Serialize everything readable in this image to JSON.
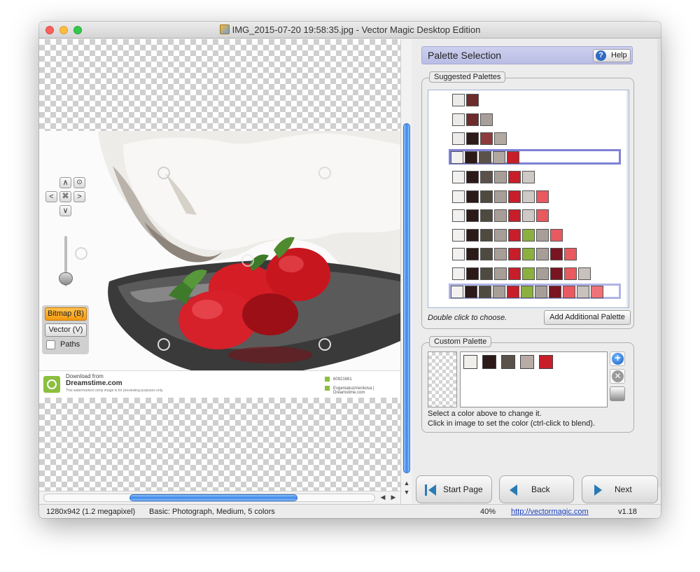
{
  "window": {
    "title": "IMG_2015-07-20 19:58:35.jpg - Vector Magic Desktop Edition"
  },
  "canvas": {
    "view_buttons": {
      "up": "∧",
      "down": "∨",
      "left": "<",
      "right": ">",
      "center": "⌘",
      "fit": "⊙"
    },
    "mode": {
      "bitmap_label": "Bitmap (B)",
      "vector_label": "Vector (V)",
      "paths_label": "Paths",
      "paths_checked": false
    },
    "watermark": {
      "download_from": "Download from",
      "site": "Dreamstime.com",
      "fine_print": "This watermarked comp image is for previewing purposes only.",
      "id": "60921661",
      "author": "Evgeniakuzmenkova | Dreamstime.com"
    }
  },
  "status": {
    "dimensions": "1280x942 (1.2 megapixel)",
    "settings": "Basic: Photograph, Medium, 5 colors",
    "zoom": "40%",
    "link": "http://vectormagic.com",
    "version": "v1.18"
  },
  "panel": {
    "header": "Palette Selection",
    "help_label": "Help",
    "suggested_legend": "Suggested Palettes",
    "palettes": [
      [
        "#ecebea",
        "#6d2b2b"
      ],
      [
        "#ecebea",
        "#6d2b2b",
        "#a99f9a"
      ],
      [
        "#ecebea",
        "#2d1b19",
        "#8e3b3d",
        "#b3a9a3"
      ],
      [
        "#f2f1f0",
        "#2c1a18",
        "#5b514b",
        "#b2a8a2",
        "#c81e2a"
      ],
      [
        "#f2f1f0",
        "#2c1a18",
        "#5b514b",
        "#a89e98",
        "#c81e2a",
        "#cfc9c6"
      ],
      [
        "#f2f1f0",
        "#2c1a18",
        "#4f4a40",
        "#a89e98",
        "#c81e2a",
        "#cfc9c6",
        "#e85a60"
      ],
      [
        "#f2f1f0",
        "#2c1a18",
        "#4f4a40",
        "#a89e98",
        "#c81e2a",
        "#cfc9c6",
        "#e85a60"
      ],
      [
        "#f2f1f0",
        "#2c1a18",
        "#4f4a40",
        "#a89e98",
        "#c81e2a",
        "#8cb040",
        "#a89e98",
        "#e85a60"
      ],
      [
        "#f2f1f0",
        "#2c1a18",
        "#4f4a40",
        "#a89e98",
        "#c81e2a",
        "#8cb040",
        "#a89e98",
        "#7a1420",
        "#e85a60"
      ],
      [
        "#f2f1f0",
        "#2c1a18",
        "#4f4a40",
        "#a89e98",
        "#c81e2a",
        "#8cb040",
        "#a89e98",
        "#7a1420",
        "#e85a60",
        "#c9c1bc"
      ],
      [
        "#f2f1f0",
        "#2c1a18",
        "#4f4a40",
        "#a89e98",
        "#c81e2a",
        "#8cb040",
        "#a89e98",
        "#7a1420",
        "#e85a60",
        "#c9c1bc",
        "#ee7278"
      ]
    ],
    "selected_palette_index": 3,
    "double_click_note": "Double click to choose.",
    "add_palette_label": "Add Additional Palette",
    "custom_legend": "Custom Palette",
    "custom_colors": [
      "#f1efec",
      "#2c1a18",
      "#5b514b",
      "#b7aba6",
      "#c81e2a"
    ],
    "custom_note_1": "Select a color above to change it.",
    "custom_note_2": "Click in image to set the color (ctrl-click to blend)."
  },
  "nav": {
    "start_label": "Start Page",
    "back_label": "Back",
    "next_label": "Next"
  },
  "colors": {
    "accent_blue": "#2f6bc4",
    "header_lavender": "#c3c6ea",
    "bitmap_orange": "#f5a623"
  }
}
